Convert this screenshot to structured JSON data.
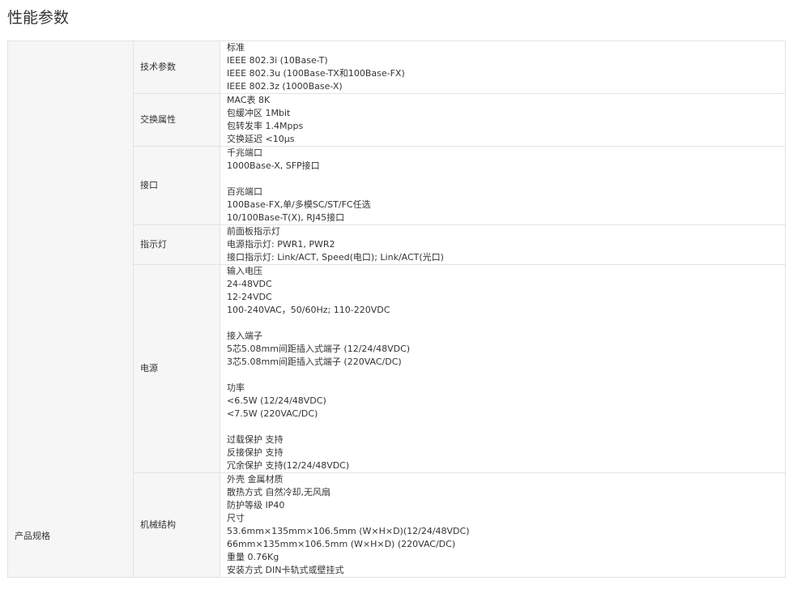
{
  "title": "性能参数",
  "category": "产品规格",
  "rows": [
    {
      "label": "技术参数",
      "lines": [
        "标准",
        "IEEE 802.3i (10Base-T)",
        "IEEE 802.3u (100Base-TX和100Base-FX)",
        "IEEE 802.3z (1000Base-X)"
      ]
    },
    {
      "label": "交换属性",
      "lines": [
        "MAC表 8K",
        "包缓冲区 1Mbit",
        "包转发率 1.4Mpps",
        "交换延迟 <10μs"
      ]
    },
    {
      "label": "接口",
      "lines": [
        "千兆端口",
        "1000Base-X, SFP接口",
        "",
        "百兆端口",
        "100Base-FX,单/多模SC/ST/FC任选",
        "10/100Base-T(X), RJ45接口"
      ]
    },
    {
      "label": "指示灯",
      "lines": [
        "前面板指示灯",
        "电源指示灯: PWR1, PWR2",
        "接口指示灯: Link/ACT, Speed(电口); Link/ACT(光口)"
      ]
    },
    {
      "label": "电源",
      "lines": [
        "输入电压",
        "24-48VDC",
        "12-24VDC",
        "100-240VAC，50/60Hz; 110-220VDC",
        "",
        "接入端子",
        "5芯5.08mm间距插入式端子 (12/24/48VDC)",
        "3芯5.08mm间距插入式端子 (220VAC/DC)",
        "",
        "功率",
        "<6.5W (12/24/48VDC)",
        "<7.5W (220VAC/DC)",
        "",
        "过载保护 支持",
        "反接保护 支持",
        "冗余保护 支持(12/24/48VDC)"
      ]
    },
    {
      "label": "机械结构",
      "lines": [
        "外壳 金属材质",
        "散热方式 自然冷却,无风扇",
        "防护等级 IP40",
        "尺寸",
        "53.6mm×135mm×106.5mm (W×H×D)(12/24/48VDC)",
        "66mm×135mm×106.5mm (W×H×D) (220VAC/DC)",
        "重量 0.76Kg",
        "安装方式 DIN卡轨式或壁挂式"
      ]
    }
  ]
}
